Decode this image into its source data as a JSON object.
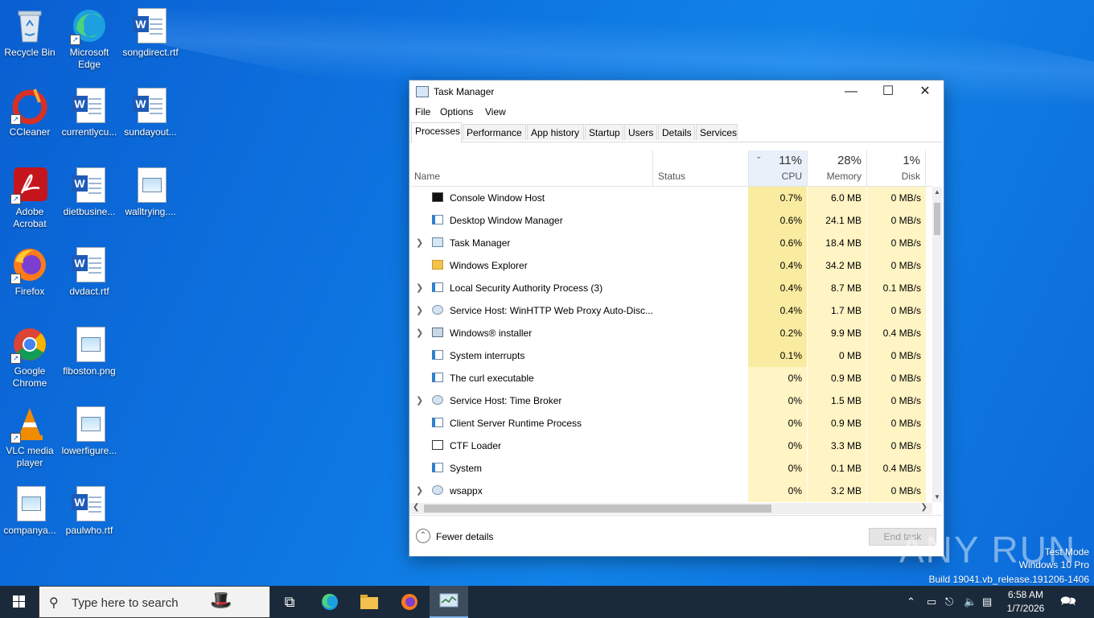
{
  "desktop": {
    "icons": [
      {
        "label": "Recycle Bin"
      },
      {
        "label": "Microsoft Edge"
      },
      {
        "label": "songdirect.rtf"
      },
      {
        "label": "CCleaner"
      },
      {
        "label": "currentlycu..."
      },
      {
        "label": "sundayout..."
      },
      {
        "label": "Adobe Acrobat"
      },
      {
        "label": "dietbusine..."
      },
      {
        "label": "walltrying...."
      },
      {
        "label": "Firefox"
      },
      {
        "label": "dvdact.rtf"
      },
      {
        "label": "Google Chrome"
      },
      {
        "label": "flboston.png"
      },
      {
        "label": "VLC media player"
      },
      {
        "label": "lowerfigure..."
      },
      {
        "label": "companya..."
      },
      {
        "label": "paulwho.rtf"
      }
    ]
  },
  "taskmanager": {
    "title": "Task Manager",
    "menu": [
      "File",
      "Options",
      "View"
    ],
    "tabs": [
      "Processes",
      "Performance",
      "App history",
      "Startup",
      "Users",
      "Details",
      "Services"
    ],
    "active_tab": "Processes",
    "columns": {
      "name": "Name",
      "status": "Status",
      "cpu_pct": "11%",
      "cpu": "CPU",
      "memory_pct": "28%",
      "memory": "Memory",
      "disk_pct": "1%",
      "disk": "Disk"
    },
    "processes": [
      {
        "name": "Console Window Host",
        "expandable": false,
        "icon": "console-icon",
        "cpu": "0.7%",
        "memory": "6.0 MB",
        "disk": "0 MB/s"
      },
      {
        "name": "Desktop Window Manager",
        "expandable": false,
        "icon": "window-icon",
        "cpu": "0.6%",
        "memory": "24.1 MB",
        "disk": "0 MB/s"
      },
      {
        "name": "Task Manager",
        "expandable": true,
        "icon": "taskmanager-icon",
        "cpu": "0.6%",
        "memory": "18.4 MB",
        "disk": "0 MB/s"
      },
      {
        "name": "Windows Explorer",
        "expandable": false,
        "icon": "folder-icon",
        "cpu": "0.4%",
        "memory": "34.2 MB",
        "disk": "0 MB/s"
      },
      {
        "name": "Local Security Authority Process (3)",
        "expandable": true,
        "icon": "window-icon",
        "cpu": "0.4%",
        "memory": "8.7 MB",
        "disk": "0.1 MB/s"
      },
      {
        "name": "Service Host: WinHTTP Web Proxy Auto-Disc...",
        "expandable": true,
        "icon": "gear-icon",
        "cpu": "0.4%",
        "memory": "1.7 MB",
        "disk": "0 MB/s"
      },
      {
        "name": "Windows® installer",
        "expandable": true,
        "icon": "installer-icon",
        "cpu": "0.2%",
        "memory": "9.9 MB",
        "disk": "0.4 MB/s"
      },
      {
        "name": "System interrupts",
        "expandable": false,
        "icon": "window-icon",
        "cpu": "0.1%",
        "memory": "0 MB",
        "disk": "0 MB/s"
      },
      {
        "name": "The curl executable",
        "expandable": false,
        "icon": "window-icon",
        "cpu": "0%",
        "memory": "0.9 MB",
        "disk": "0 MB/s"
      },
      {
        "name": "Service Host: Time Broker",
        "expandable": true,
        "icon": "gear-icon",
        "cpu": "0%",
        "memory": "1.5 MB",
        "disk": "0 MB/s"
      },
      {
        "name": "Client Server Runtime Process",
        "expandable": false,
        "icon": "window-icon",
        "cpu": "0%",
        "memory": "0.9 MB",
        "disk": "0 MB/s"
      },
      {
        "name": "CTF Loader",
        "expandable": false,
        "icon": "pen-icon",
        "cpu": "0%",
        "memory": "3.3 MB",
        "disk": "0 MB/s"
      },
      {
        "name": "System",
        "expandable": false,
        "icon": "window-icon",
        "cpu": "0%",
        "memory": "0.1 MB",
        "disk": "0.4 MB/s"
      },
      {
        "name": "wsappx",
        "expandable": true,
        "icon": "gear-icon",
        "cpu": "0%",
        "memory": "3.2 MB",
        "disk": "0 MB/s"
      }
    ],
    "footer": {
      "fewer_details": "Fewer details",
      "end_task": "End task"
    }
  },
  "watermark": {
    "brand": "ANY RUN",
    "line1": "Test Mode",
    "line2": "Windows 10 Pro",
    "line3": "Build 19041.vb_release.191206-1406"
  },
  "taskbar": {
    "search_placeholder": "Type here to search",
    "time": "6:58 AM",
    "date": "1/7/2026"
  },
  "colors": {
    "cpu_high": "#f9eca0",
    "cpu_low": "#fff4c4",
    "desktop": "#0d74e0",
    "taskbar": "#1b2a3a"
  }
}
